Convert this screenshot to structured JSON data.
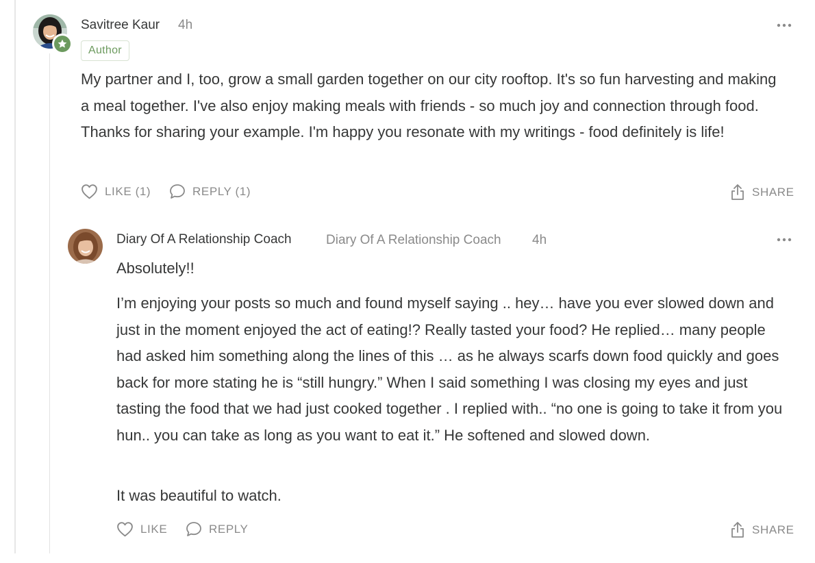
{
  "comment": {
    "author": "Savitree Kaur",
    "time": "4h",
    "badge": "Author",
    "paragraphs": [
      "My partner and I, too, grow a small garden together on our city rooftop. It's so fun harvesting and making a meal together. I've also enjoy making meals with friends - so much joy and connection through food. Thanks for sharing your example. I'm happy you resonate with my writings - food definitely is life!"
    ],
    "actions": {
      "like": "LIKE (1)",
      "reply": "REPLY (1)",
      "share": "SHARE"
    }
  },
  "reply": {
    "author": "Diary Of A Relationship Coach",
    "publication": "Diary Of A Relationship Coach",
    "time": "4h",
    "paragraphs": [
      "Absolutely!!",
      "I’m enjoying your posts so much and found myself saying .. hey… have you ever slowed down and just in the moment enjoyed the act of eating!? Really tasted your food? He replied… many people had asked him something along the lines of this … as he always scarfs down food quickly and goes back for more stating he is “still hungry.” When I said something I was closing my eyes and just tasting the food that we had just cooked together . I replied with.. “no one is going to take it from you hun.. you can take as long as you want to eat it.” He softened and slowed down.",
      "It was beautiful to watch."
    ],
    "actions": {
      "like": "LIKE",
      "reply": "REPLY",
      "share": "SHARE"
    }
  },
  "colors": {
    "text": "#363737",
    "muted": "#8a8a8a",
    "accent_green": "#6c9a5e"
  }
}
